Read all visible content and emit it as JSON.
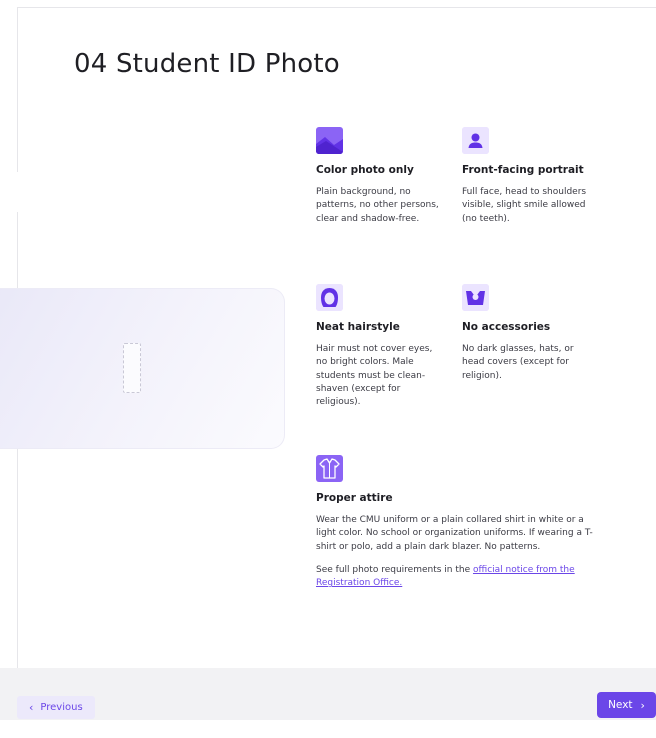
{
  "page": {
    "title": "04 Student ID Photo"
  },
  "requirements": {
    "color": {
      "icon": "landscape-photo-icon",
      "title": "Color photo only",
      "desc": "Plain background, no patterns, no other persons, clear and shadow-free."
    },
    "front": {
      "icon": "person-portrait-icon",
      "title": "Front-facing portrait",
      "desc": "Full face, head to shoulders visible, slight smile allowed (no teeth)."
    },
    "hair": {
      "icon": "hairstyle-icon",
      "title": "Neat hairstyle",
      "desc": "Hair must not cover eyes, no bright colors. Male students must be clean-shaven (except for religious)."
    },
    "accessories": {
      "icon": "no-accessories-icon",
      "title": "No accessories",
      "desc": "No dark glasses, hats, or head covers (except for religion)."
    },
    "attire": {
      "icon": "shirt-icon",
      "title": "Proper attire",
      "desc": "Wear the CMU uniform or a plain collared shirt in white or a light color. No school or organization uniforms. If wearing a T-shirt or polo, add a plain dark blazer. No patterns."
    }
  },
  "note": {
    "prefix": "See full photo requirements in the ",
    "link": "official notice from the Registration Office."
  },
  "nav": {
    "previous": "Previous",
    "next": "Next"
  },
  "colors": {
    "accent": "#6b46e8",
    "icon_bg": "#ebe4ff",
    "footer_bg": "#f2f2f4"
  }
}
